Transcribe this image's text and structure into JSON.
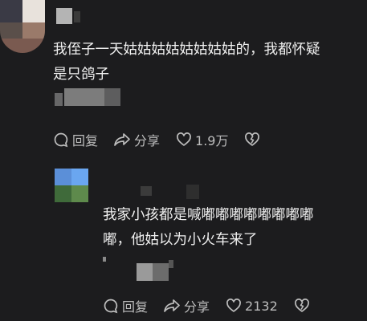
{
  "comments": [
    {
      "text_line1": "我侄子一天姑姑姑姑姑姑姑姑的，我都怀疑",
      "text_line2": "是只鸽子",
      "actions": {
        "reply": "回复",
        "share": "分享",
        "likes": "1.9万"
      }
    },
    {
      "text_line1": "我家小孩都是喊嘟嘟嘟嘟嘟嘟嘟嘟",
      "text_line2": "嘟，他姑以为小火车来了",
      "actions": {
        "reply": "回复",
        "share": "分享",
        "likes": "2132"
      }
    }
  ],
  "icons": [
    "reply-icon",
    "share-icon",
    "like-icon",
    "dislike-icon"
  ],
  "colors": {
    "background": "#1c1c1e",
    "text": "#f0f0f0",
    "muted": "#bdbdbd"
  }
}
